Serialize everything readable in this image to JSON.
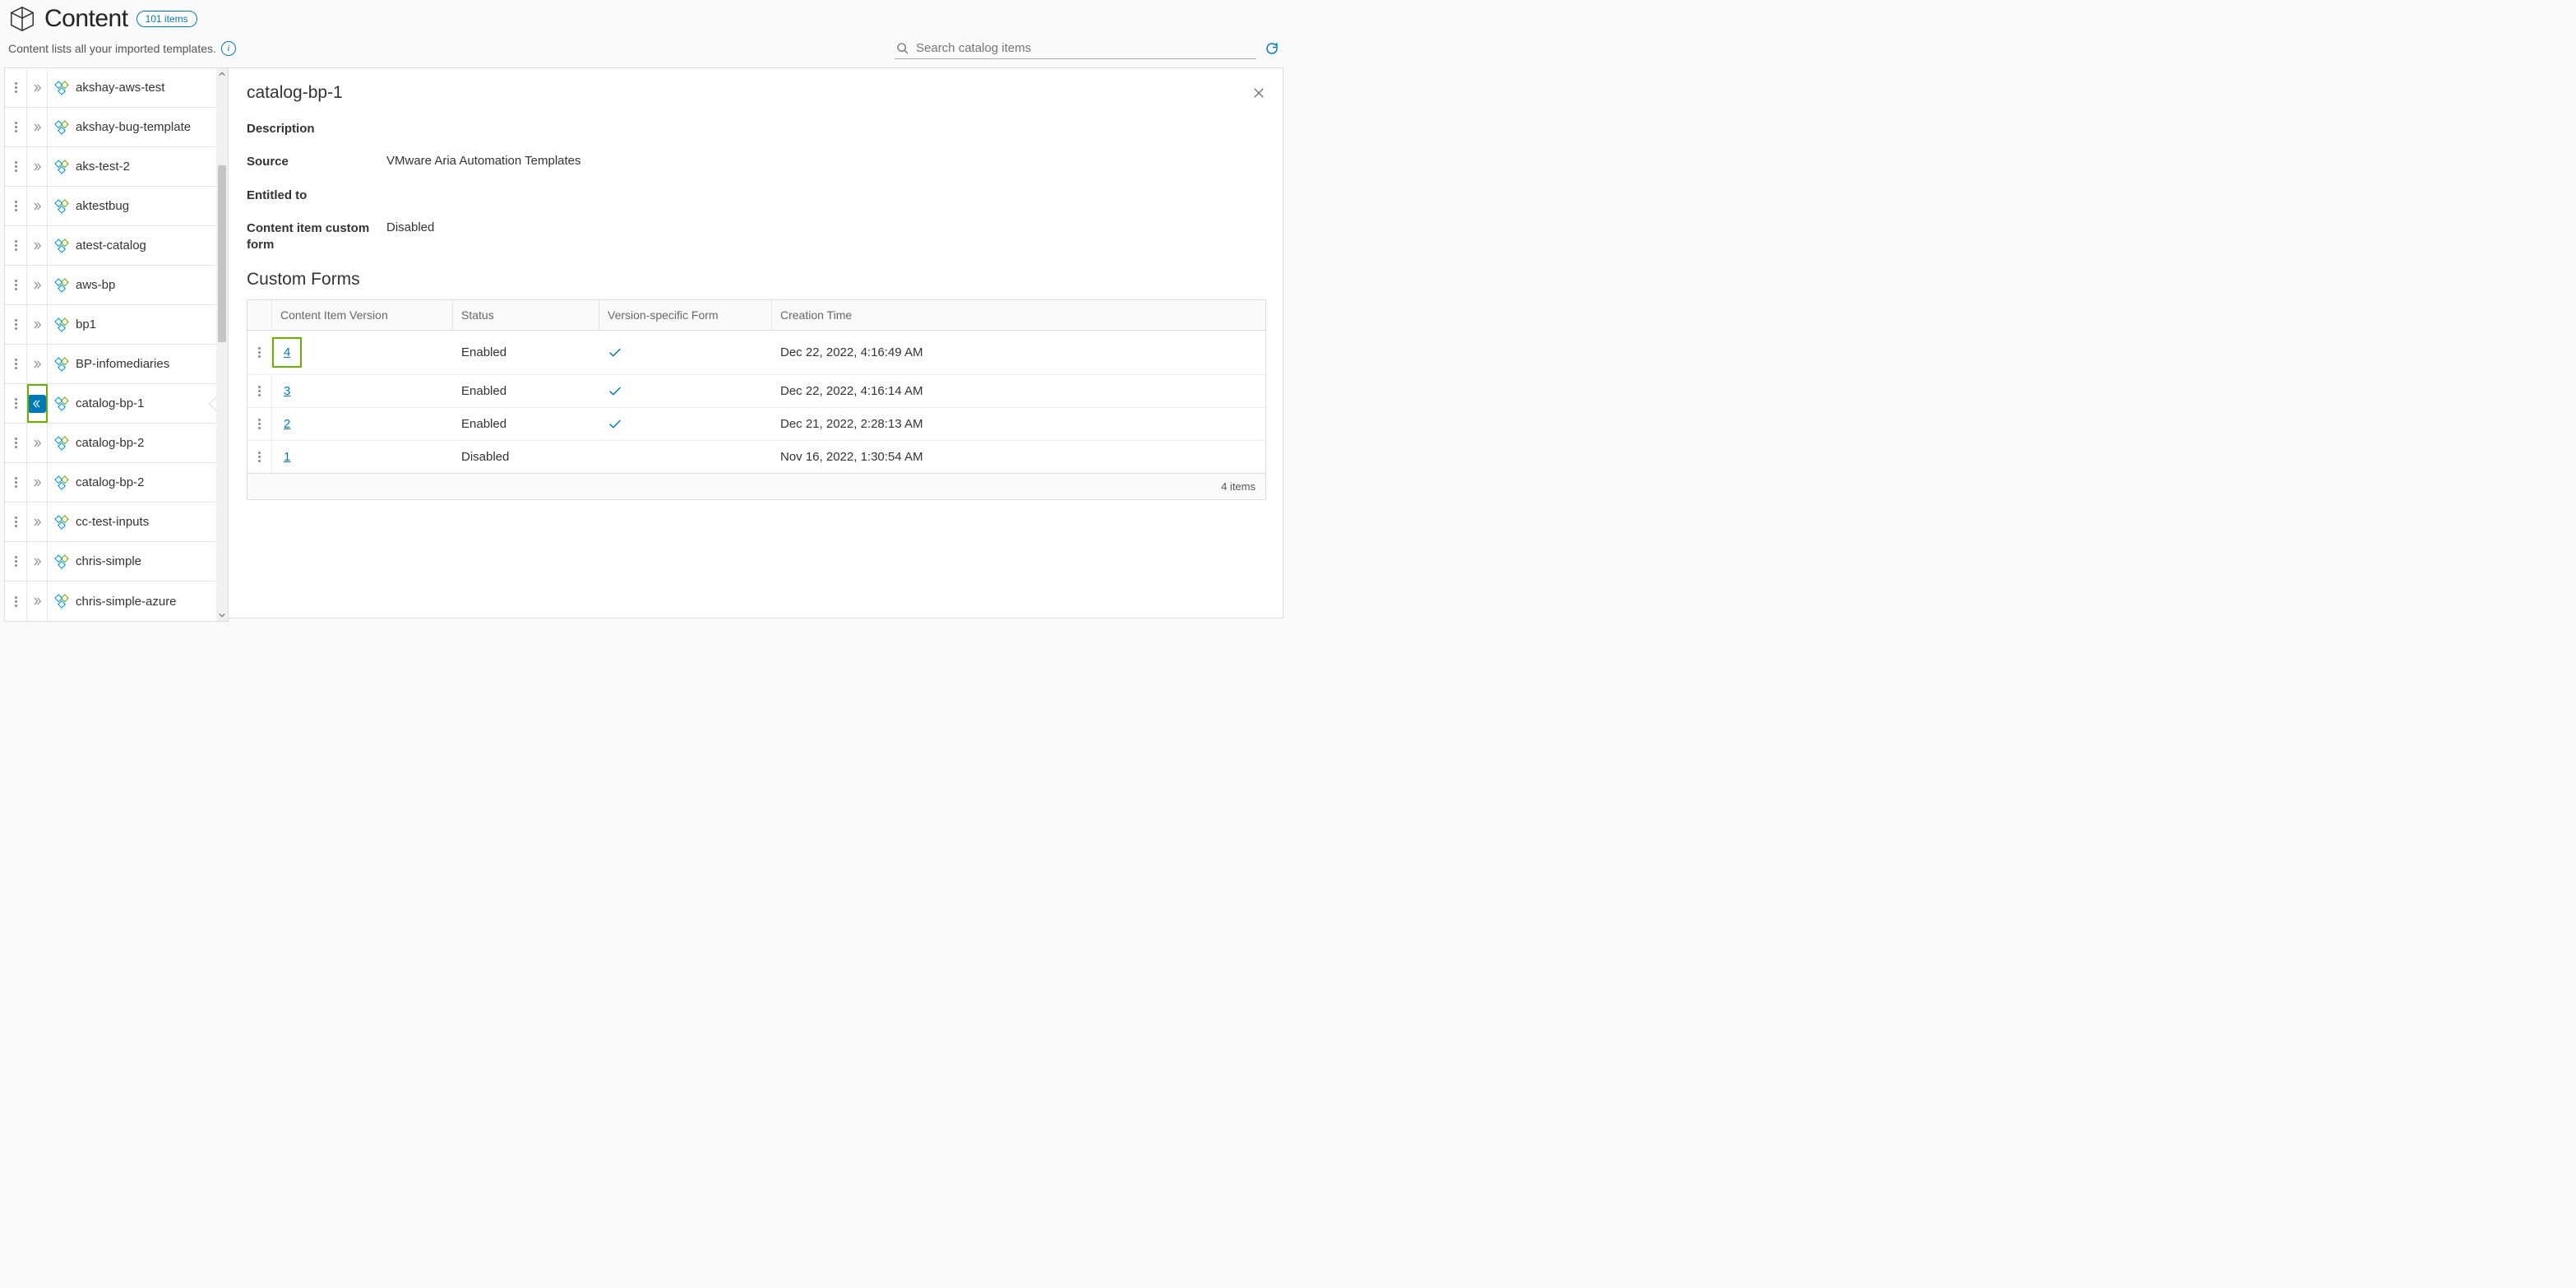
{
  "header": {
    "title": "Content",
    "badge": "101 items",
    "subtitle": "Content lists all your imported templates.",
    "search_placeholder": "Search catalog items"
  },
  "list": [
    {
      "name": "akshay-aws-test",
      "selected": false
    },
    {
      "name": "akshay-bug-template",
      "selected": false
    },
    {
      "name": "aks-test-2",
      "selected": false
    },
    {
      "name": "aktestbug",
      "selected": false
    },
    {
      "name": "atest-catalog",
      "selected": false
    },
    {
      "name": "aws-bp",
      "selected": false
    },
    {
      "name": "bp1",
      "selected": false
    },
    {
      "name": "BP-infomediaries",
      "selected": false
    },
    {
      "name": "catalog-bp-1",
      "selected": true
    },
    {
      "name": "catalog-bp-2",
      "selected": false
    },
    {
      "name": "catalog-bp-2",
      "selected": false
    },
    {
      "name": "cc-test-inputs",
      "selected": false
    },
    {
      "name": "chris-simple",
      "selected": false
    },
    {
      "name": "chris-simple-azure",
      "selected": false
    }
  ],
  "detail": {
    "title": "catalog-bp-1",
    "fields": {
      "description_label": "Description",
      "description_value": "",
      "source_label": "Source",
      "source_value": "VMware Aria Automation Templates",
      "entitled_label": "Entitled to",
      "entitled_value": "",
      "cform_label": "Content item custom form",
      "cform_value": "Disabled"
    },
    "custom_forms": {
      "title": "Custom Forms",
      "columns": {
        "version": "Content Item Version",
        "status": "Status",
        "form": "Version-specific Form",
        "time": "Creation Time"
      },
      "rows": [
        {
          "version": "4",
          "status": "Enabled",
          "form_check": true,
          "time": "Dec 22, 2022, 4:16:49 AM",
          "highlighted": true
        },
        {
          "version": "3",
          "status": "Enabled",
          "form_check": true,
          "time": "Dec 22, 2022, 4:16:14 AM",
          "highlighted": false
        },
        {
          "version": "2",
          "status": "Enabled",
          "form_check": true,
          "time": "Dec 21, 2022, 2:28:13 AM",
          "highlighted": false
        },
        {
          "version": "1",
          "status": "Disabled",
          "form_check": false,
          "time": "Nov 16, 2022, 1:30:54 AM",
          "highlighted": false
        }
      ],
      "footer": "4 items"
    }
  }
}
